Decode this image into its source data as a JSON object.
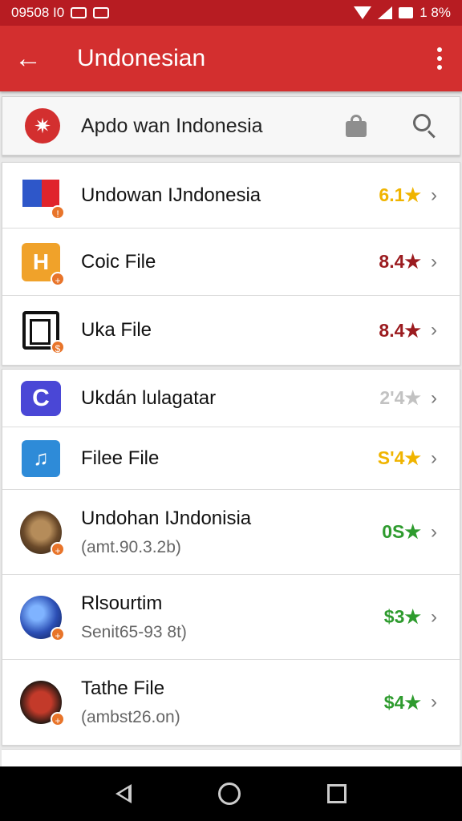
{
  "status_bar": {
    "time": "09508 I0",
    "battery": "1 8%"
  },
  "app_bar": {
    "title": "Undonesian"
  },
  "search": {
    "text": "Apdo wan Indonesia"
  },
  "colors": {
    "primary": "#d32f2f",
    "status": "#b71c22"
  },
  "groups": [
    {
      "items": [
        {
          "name": "Undowan IJndonesia",
          "rating": "6.1★",
          "rating_color": "#f0b400",
          "icon": "flag-icon"
        },
        {
          "name": "Coic File",
          "rating": "8.4★",
          "rating_color": "#9b1b1f",
          "icon": "h-app-icon",
          "glyph": "H"
        },
        {
          "name": "Uka File",
          "rating": "8.4★",
          "rating_color": "#9b1b1f",
          "icon": "document-icon"
        }
      ]
    },
    {
      "items": [
        {
          "name": "Ukdán lulagatar",
          "rating": "2'4★",
          "rating_color": "#c2c2c2",
          "icon": "c-app-icon",
          "glyph": "C"
        },
        {
          "name": "Filee File",
          "rating": "S'4★",
          "rating_color": "#f0b400",
          "icon": "music-app-icon",
          "glyph": "♫"
        },
        {
          "name": "Undohan IJndonisia",
          "sub": "(amt.90.3.2b)",
          "rating": "0S★",
          "rating_color": "#2e9b2e",
          "icon": "photo-avatar-icon"
        },
        {
          "name": "Rlsourtim",
          "sub": "Senit65-93 8t)",
          "rating": "$3★",
          "rating_color": "#2e9b2e",
          "icon": "globe-icon"
        },
        {
          "name": "Tathe File",
          "sub": "(ambst26.on)",
          "rating": "$4★",
          "rating_color": "#2e9b2e",
          "icon": "film-icon"
        }
      ]
    }
  ]
}
